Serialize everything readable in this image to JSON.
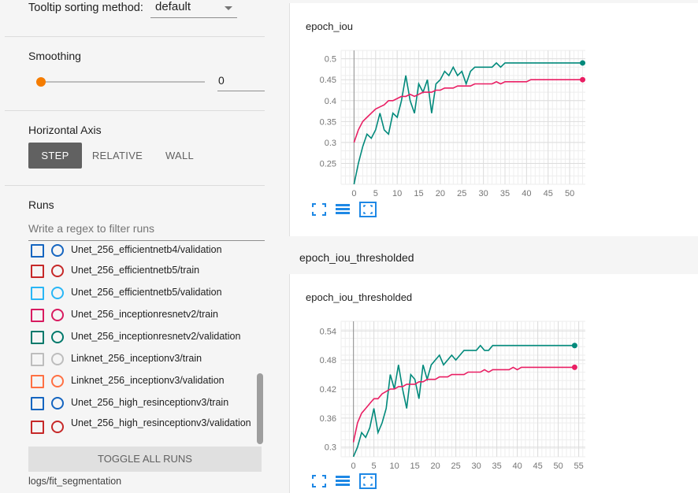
{
  "sidebar": {
    "tooltip_sort_label": "Tooltip sorting method:",
    "tooltip_sort_value": "default",
    "smoothing_label": "Smoothing",
    "smoothing_value": "0",
    "horizontal_axis_label": "Horizontal Axis",
    "axis_options": [
      "STEP",
      "RELATIVE",
      "WALL"
    ],
    "axis_selected": "STEP",
    "runs_label": "Runs",
    "regex_placeholder": "Write a regex to filter runs",
    "runs": [
      {
        "name": "Unet_256_efficientnetb4/validation",
        "color": "#1565c0"
      },
      {
        "name": "Unet_256_efficientnetb5/train",
        "color": "#c62828"
      },
      {
        "name": "Unet_256_efficientnetb5/validation",
        "color": "#29b6f6"
      },
      {
        "name": "Unet_256_inceptionresnetv2/train",
        "color": "#d81b60"
      },
      {
        "name": "Unet_256_inceptionresnetv2/validation",
        "color": "#00796b"
      },
      {
        "name": "Linknet_256_inceptionv3/train",
        "color": "#bdbdbd"
      },
      {
        "name": "Linknet_256_inceptionv3/validation",
        "color": "#ff7043"
      },
      {
        "name": "Unet_256_high_resinceptionv3/train",
        "color": "#1565c0"
      },
      {
        "name": "Unet_256_high_resinceptionv3/validation",
        "color": "#c62828"
      }
    ],
    "toggle_all_label": "TOGGLE ALL RUNS",
    "logs_dir": "logs/fit_segmentation"
  },
  "main": {
    "group_title": "epoch_iou_thresholded",
    "accent_green": "#00897b",
    "accent_pink": "#e91e63"
  },
  "chart_data": [
    {
      "type": "line",
      "title": "epoch_iou",
      "xticks": [
        0,
        5,
        10,
        15,
        20,
        25,
        30,
        35,
        40,
        45,
        50
      ],
      "yticks": [
        "0.25",
        "0.3",
        "0.35",
        "0.4",
        "0.45",
        "0.5"
      ],
      "xlim": [
        -3,
        54
      ],
      "ylim": [
        0.2,
        0.52
      ],
      "grid": true,
      "series": [
        {
          "color": "#00897b",
          "x": [
            0,
            1,
            2,
            3,
            4,
            5,
            6,
            7,
            8,
            9,
            10,
            11,
            12,
            13,
            14,
            15,
            16,
            17,
            18,
            19,
            20,
            21,
            22,
            23,
            24,
            25,
            26,
            27,
            28,
            29,
            30,
            31,
            32,
            33,
            34,
            35,
            36,
            37,
            38,
            39,
            40,
            41,
            42,
            43,
            44,
            45,
            46,
            47,
            48,
            49,
            50,
            51,
            52,
            53
          ],
          "values": [
            0.2,
            0.25,
            0.29,
            0.32,
            0.31,
            0.33,
            0.37,
            0.33,
            0.32,
            0.37,
            0.36,
            0.4,
            0.46,
            0.4,
            0.37,
            0.44,
            0.42,
            0.45,
            0.37,
            0.44,
            0.45,
            0.47,
            0.46,
            0.48,
            0.46,
            0.47,
            0.44,
            0.47,
            0.48,
            0.48,
            0.48,
            0.48,
            0.48,
            0.49,
            0.48,
            0.49,
            0.49,
            0.49,
            0.49,
            0.49,
            0.49,
            0.49,
            0.49,
            0.49,
            0.49,
            0.49,
            0.49,
            0.49,
            0.49,
            0.49,
            0.49,
            0.49,
            0.49,
            0.49
          ]
        },
        {
          "color": "#e91e63",
          "x": [
            0,
            1,
            2,
            3,
            4,
            5,
            6,
            7,
            8,
            9,
            10,
            11,
            12,
            13,
            14,
            15,
            16,
            17,
            18,
            19,
            20,
            21,
            22,
            23,
            24,
            25,
            26,
            27,
            28,
            29,
            30,
            31,
            32,
            33,
            34,
            35,
            36,
            37,
            38,
            39,
            40,
            41,
            42,
            43,
            44,
            45,
            46,
            47,
            48,
            49,
            50,
            51,
            52,
            53
          ],
          "values": [
            0.3,
            0.33,
            0.35,
            0.36,
            0.37,
            0.38,
            0.385,
            0.39,
            0.4,
            0.4,
            0.405,
            0.41,
            0.41,
            0.415,
            0.41,
            0.415,
            0.42,
            0.42,
            0.42,
            0.425,
            0.425,
            0.43,
            0.43,
            0.43,
            0.435,
            0.435,
            0.435,
            0.435,
            0.44,
            0.44,
            0.44,
            0.44,
            0.44,
            0.445,
            0.44,
            0.445,
            0.445,
            0.445,
            0.445,
            0.445,
            0.445,
            0.45,
            0.45,
            0.45,
            0.45,
            0.45,
            0.45,
            0.45,
            0.45,
            0.45,
            0.45,
            0.45,
            0.45,
            0.45
          ]
        }
      ]
    },
    {
      "type": "line",
      "title": "epoch_iou_thresholded",
      "xticks": [
        0,
        5,
        10,
        15,
        20,
        25,
        30,
        35,
        40,
        45,
        50,
        55
      ],
      "yticks": [
        "0.3",
        "0.36",
        "0.42",
        "0.48",
        "0.54"
      ],
      "xlim": [
        -3,
        57
      ],
      "ylim": [
        0.28,
        0.56
      ],
      "grid": true,
      "series": [
        {
          "color": "#00897b",
          "x": [
            0,
            1,
            2,
            3,
            4,
            5,
            6,
            7,
            8,
            9,
            10,
            11,
            12,
            13,
            14,
            15,
            16,
            17,
            18,
            19,
            20,
            21,
            22,
            23,
            24,
            25,
            26,
            27,
            28,
            29,
            30,
            31,
            32,
            33,
            34,
            35,
            36,
            37,
            38,
            39,
            40,
            41,
            42,
            43,
            44,
            45,
            46,
            47,
            48,
            49,
            50,
            51,
            52,
            53,
            54
          ],
          "values": [
            0.28,
            0.3,
            0.33,
            0.32,
            0.34,
            0.38,
            0.33,
            0.35,
            0.38,
            0.45,
            0.42,
            0.47,
            0.42,
            0.38,
            0.45,
            0.44,
            0.4,
            0.47,
            0.44,
            0.47,
            0.48,
            0.49,
            0.47,
            0.48,
            0.49,
            0.48,
            0.49,
            0.5,
            0.5,
            0.5,
            0.5,
            0.51,
            0.5,
            0.5,
            0.51,
            0.51,
            0.51,
            0.51,
            0.51,
            0.51,
            0.51,
            0.51,
            0.51,
            0.51,
            0.51,
            0.51,
            0.51,
            0.51,
            0.51,
            0.51,
            0.51,
            0.51,
            0.51,
            0.51,
            0.51
          ]
        },
        {
          "color": "#e91e63",
          "x": [
            0,
            1,
            2,
            3,
            4,
            5,
            6,
            7,
            8,
            9,
            10,
            11,
            12,
            13,
            14,
            15,
            16,
            17,
            18,
            19,
            20,
            21,
            22,
            23,
            24,
            25,
            26,
            27,
            28,
            29,
            30,
            31,
            32,
            33,
            34,
            35,
            36,
            37,
            38,
            39,
            40,
            41,
            42,
            43,
            44,
            45,
            46,
            47,
            48,
            49,
            50,
            51,
            52,
            53,
            54
          ],
          "values": [
            0.31,
            0.35,
            0.37,
            0.38,
            0.39,
            0.4,
            0.4,
            0.41,
            0.415,
            0.42,
            0.42,
            0.425,
            0.425,
            0.43,
            0.43,
            0.43,
            0.435,
            0.435,
            0.44,
            0.44,
            0.44,
            0.445,
            0.445,
            0.445,
            0.45,
            0.45,
            0.45,
            0.45,
            0.455,
            0.455,
            0.455,
            0.455,
            0.46,
            0.455,
            0.46,
            0.46,
            0.46,
            0.46,
            0.46,
            0.465,
            0.46,
            0.465,
            0.465,
            0.465,
            0.465,
            0.465,
            0.465,
            0.465,
            0.465,
            0.465,
            0.465,
            0.465,
            0.465,
            0.465,
            0.465
          ]
        }
      ]
    }
  ]
}
